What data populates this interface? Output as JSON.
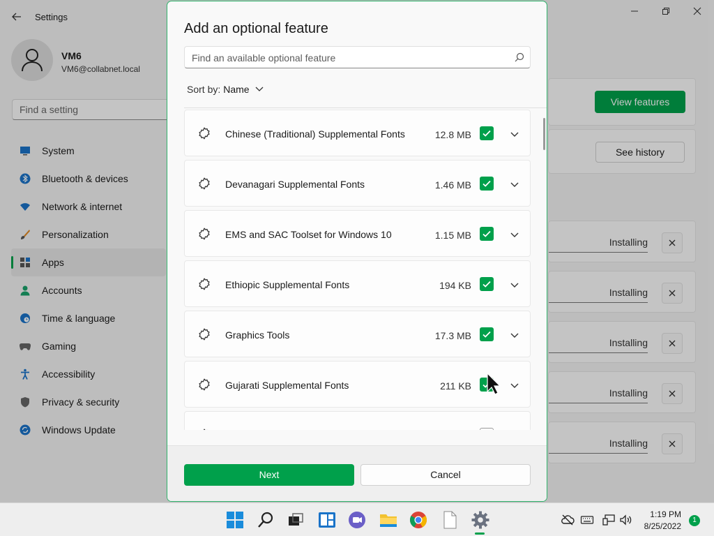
{
  "settings": {
    "app_title": "Settings",
    "user": {
      "name": "VM6",
      "email": "VM6@collabnet.local"
    },
    "search_placeholder": "Find a setting",
    "nav": [
      {
        "label": "System",
        "icon": "monitor-icon",
        "active": false
      },
      {
        "label": "Bluetooth & devices",
        "icon": "bluetooth-icon",
        "active": false
      },
      {
        "label": "Network & internet",
        "icon": "wifi-icon",
        "active": false
      },
      {
        "label": "Personalization",
        "icon": "brush-icon",
        "active": false
      },
      {
        "label": "Apps",
        "icon": "apps-icon",
        "active": true
      },
      {
        "label": "Accounts",
        "icon": "person-icon",
        "active": false
      },
      {
        "label": "Time & language",
        "icon": "globe-clock-icon",
        "active": false
      },
      {
        "label": "Gaming",
        "icon": "gamepad-icon",
        "active": false
      },
      {
        "label": "Accessibility",
        "icon": "accessibility-icon",
        "active": false
      },
      {
        "label": "Privacy & security",
        "icon": "shield-icon",
        "active": false
      },
      {
        "label": "Windows Update",
        "icon": "update-icon",
        "active": false
      }
    ],
    "view_features_label": "View features",
    "see_history_label": "See history",
    "installing": [
      {
        "status": "Installing"
      },
      {
        "status": "Installing"
      },
      {
        "status": "Installing"
      },
      {
        "status": "Installing"
      },
      {
        "status": "Installing"
      }
    ]
  },
  "dialog": {
    "title": "Add an optional feature",
    "search_placeholder": "Find an available optional feature",
    "sort_label": "Sort by:",
    "sort_value": "Name",
    "features": [
      {
        "name": "Chinese (Traditional) Supplemental Fonts",
        "size": "12.8 MB",
        "checked": true
      },
      {
        "name": "Devanagari Supplemental Fonts",
        "size": "1.46 MB",
        "checked": true
      },
      {
        "name": "EMS and SAC Toolset for Windows 10",
        "size": "1.15 MB",
        "checked": true
      },
      {
        "name": "Ethiopic Supplemental Fonts",
        "size": "194 KB",
        "checked": true
      },
      {
        "name": "Graphics Tools",
        "size": "17.3 MB",
        "checked": true
      },
      {
        "name": "Gujarati Supplemental Fonts",
        "size": "211 KB",
        "checked": true
      }
    ],
    "next_label": "Next",
    "cancel_label": "Cancel"
  },
  "taskbar": {
    "time": "1:19 PM",
    "date": "8/25/2022",
    "notification_count": "1",
    "accent": "#00a04b"
  }
}
